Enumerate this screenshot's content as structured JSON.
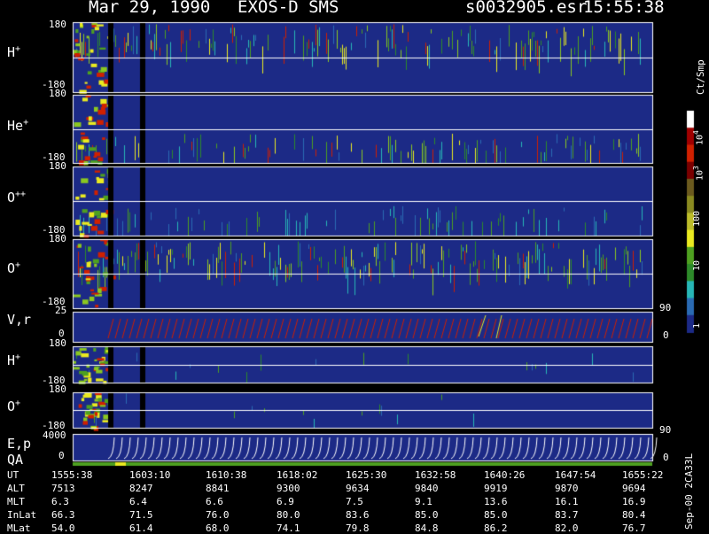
{
  "header": {
    "date": "Mar 29, 1990",
    "instrument": "EXOS-D SMS",
    "file": "s0032905.esr",
    "time": "15:55:38"
  },
  "chart_data": {
    "type": "heatmap",
    "panels": [
      {
        "label": "H",
        "ion_charge": "+",
        "ylim": [
          -180,
          180
        ],
        "yticks": [
          "180",
          "-180"
        ]
      },
      {
        "label": "He",
        "ion_charge": "+",
        "ylim": [
          -180,
          180
        ],
        "yticks": [
          "180",
          "-180"
        ]
      },
      {
        "label": "O",
        "ion_charge": "++",
        "ylim": [
          -180,
          180
        ],
        "yticks": [
          "180",
          "-180"
        ]
      },
      {
        "label": "O",
        "ion_charge": "+",
        "ylim": [
          -180,
          180
        ],
        "yticks": [
          "180",
          "-180"
        ],
        "right_tick": "90"
      },
      {
        "label": "V,r",
        "ylim": [
          0,
          25
        ],
        "yticks": [
          "25",
          "0"
        ],
        "right_tick": "0",
        "type": "line"
      },
      {
        "label": "H",
        "ion_charge": "+",
        "ylim": [
          -180,
          180
        ],
        "yticks": [
          "180",
          "-180"
        ]
      },
      {
        "label": "O",
        "ion_charge": "+",
        "ylim": [
          -180,
          180
        ],
        "yticks": [
          "180",
          "-180"
        ],
        "right_tick": "90"
      },
      {
        "label": "E,p",
        "label2": "QA",
        "ylim": [
          0,
          4000
        ],
        "yticks": [
          "4000",
          "0"
        ],
        "right_tick": "0",
        "type": "line"
      }
    ],
    "colorbar": {
      "unit": "Ct/Smp",
      "labels": [
        "10^4",
        "10^3",
        "100",
        "10",
        "1"
      ],
      "colors": [
        "#ffffff",
        "#a00000",
        "#d02000",
        "#7a0000",
        "#6b5a1e",
        "#8a8a20",
        "#bcbc2a",
        "#eaea20",
        "#4ea020",
        "#2d8a2a",
        "#27b6b6",
        "#2a6ab2",
        "#1c2a86"
      ]
    },
    "footer": {
      "rows": [
        {
          "label": "UT",
          "values": [
            "1555:38",
            "1603:10",
            "1610:38",
            "1618:02",
            "1625:30",
            "1632:58",
            "1640:26",
            "1647:54",
            "1655:22"
          ]
        },
        {
          "label": "ALT",
          "values": [
            "7513",
            "8247",
            "8841",
            "9300",
            "9634",
            "9840",
            "9919",
            "9870",
            "9694"
          ]
        },
        {
          "label": "MLT",
          "values": [
            "6.3",
            "6.4",
            "6.6",
            "6.9",
            "7.5",
            "9.1",
            "13.6",
            "16.1",
            "16.9"
          ]
        },
        {
          "label": "InLat",
          "values": [
            "66.3",
            "71.5",
            "76.0",
            "80.0",
            "83.6",
            "85.0",
            "85.0",
            "83.7",
            "80.4"
          ]
        },
        {
          "label": "MLat",
          "values": [
            "54.0",
            "61.4",
            "68.0",
            "74.1",
            "79.8",
            "84.8",
            "86.2",
            "82.0",
            "76.7"
          ]
        }
      ]
    },
    "side_label": "Sep-00 2CA33L"
  }
}
